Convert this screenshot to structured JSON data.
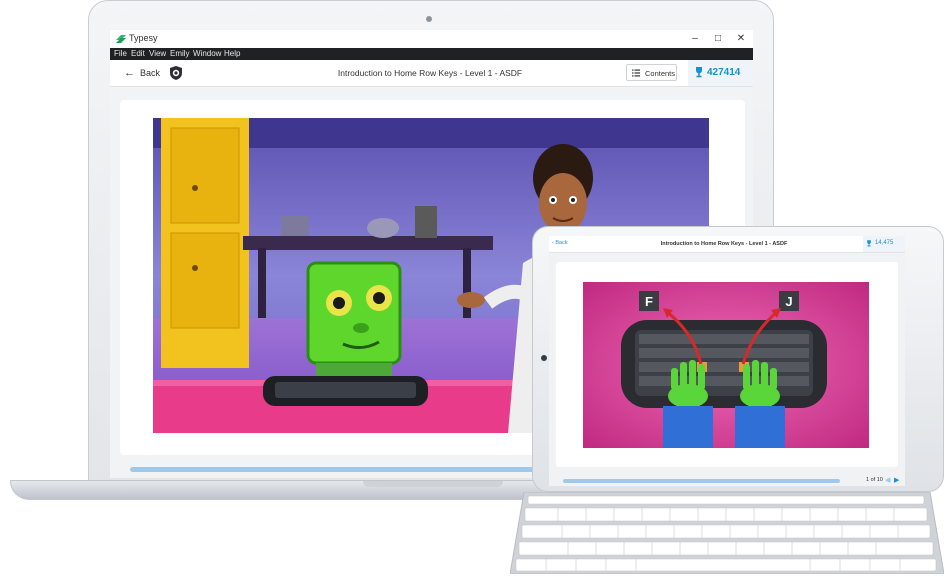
{
  "colors": {
    "accent": "#1b8fd0",
    "menubar": "#1f2124",
    "progress": "#9ec9ea",
    "brand_green": "#2bb673"
  },
  "window": {
    "app_name": "Typesy",
    "minimize_icon": "minimize-icon",
    "maximize_icon": "maximize-icon",
    "close_icon": "close-icon"
  },
  "menu": {
    "items": [
      "File",
      "Edit",
      "View",
      "Emily",
      "Window",
      "Help"
    ]
  },
  "navbar": {
    "back_label": "Back",
    "lesson_title": "Introduction to Home Row Keys - Level 1 - ASDF",
    "contents_label": "Contents",
    "score": "427414"
  },
  "tablet": {
    "back_label": "Back",
    "lesson_title": "Introduction to Home Row Keys - Level 1 - ASDF",
    "score": "14,475",
    "page_indicator": "1 of 10",
    "key_left": "F",
    "key_right": "J"
  }
}
